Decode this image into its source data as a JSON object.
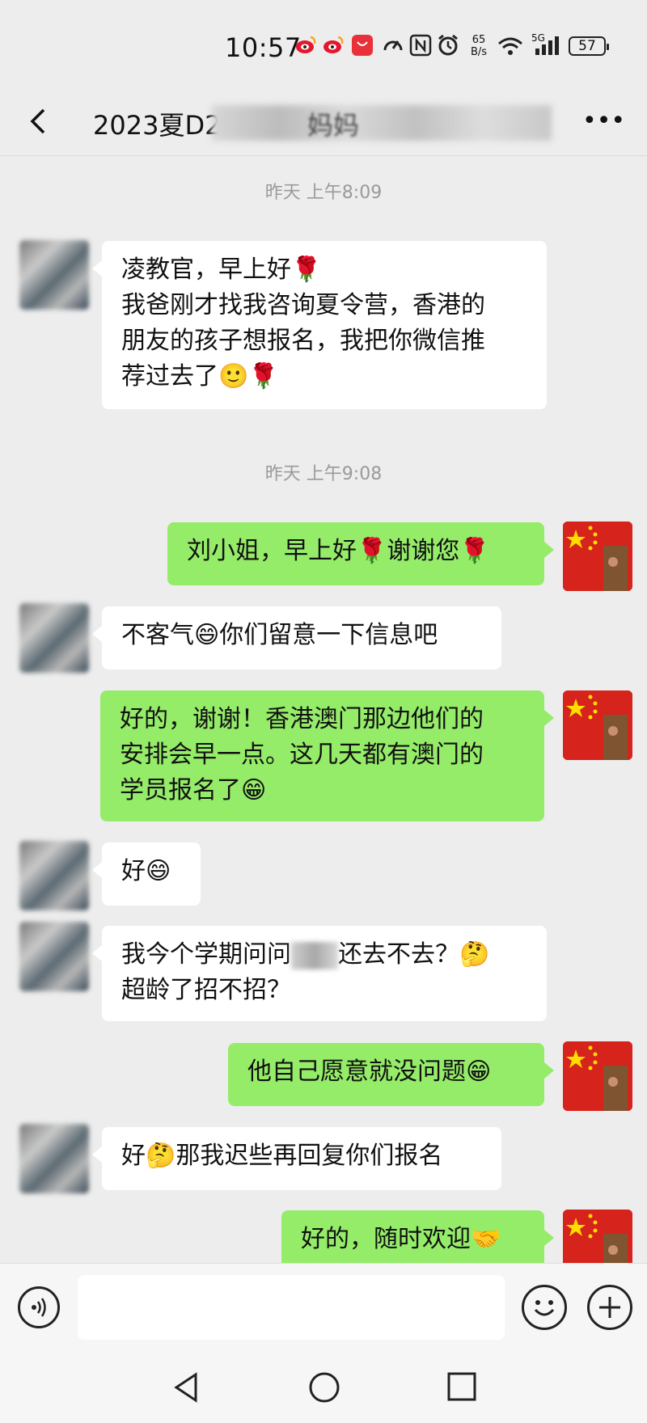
{
  "status": {
    "time": "10:57",
    "net_speed_value": "65",
    "net_speed_unit": "B/s",
    "signal_label": "5G",
    "battery": "57",
    "icons": [
      "weibo-icon",
      "weibo-icon",
      "huawei-app-icon",
      "speed-icon",
      "nfc-icon",
      "alarm-icon",
      "wifi-icon",
      "signal-icon",
      "battery-icon"
    ]
  },
  "header": {
    "title": "2023夏D2",
    "title_tail": "妈妈"
  },
  "messages": [
    {
      "type": "time",
      "text": "昨天 上午8:09"
    },
    {
      "type": "msg",
      "side": "left",
      "lines": [
        "凌教官，早上好🌹",
        "我爸刚才找我咨询夏令营，香港的",
        "朋友的孩子想报名，我把你微信推",
        "荐过去了🙂🌹"
      ]
    },
    {
      "type": "time",
      "text": "昨天 上午9:08"
    },
    {
      "type": "msg",
      "side": "right",
      "lines": [
        "刘小姐，早上好🌹谢谢您🌹"
      ]
    },
    {
      "type": "msg",
      "side": "left",
      "lines": [
        "不客气😄你们留意一下信息吧"
      ]
    },
    {
      "type": "msg",
      "side": "right",
      "lines": [
        "好的，谢谢！香港澳门那边他们的",
        "安排会早一点。这几天都有澳门的",
        "学员报名了😁"
      ]
    },
    {
      "type": "msg",
      "side": "left",
      "lines": [
        "好😄"
      ]
    },
    {
      "type": "msg",
      "side": "left",
      "line1_a": "我今个学期问问",
      "line1_b": "还去不去？🤔",
      "line2": "超龄了招不招？"
    },
    {
      "type": "msg",
      "side": "right",
      "lines": [
        "他自己愿意就没问题😁"
      ]
    },
    {
      "type": "msg",
      "side": "left",
      "lines": [
        "好🤔那我迟些再回复你们报名"
      ]
    },
    {
      "type": "msg",
      "side": "right",
      "lines": [
        "好的，随时欢迎🤝"
      ]
    }
  ],
  "input": {
    "placeholder": "",
    "voice_icon": "voice-icon",
    "emoji_icon": "emoji-icon",
    "plus_icon": "plus-icon"
  },
  "colors": {
    "bg": "#ededed",
    "bubble_left": "#ffffff",
    "bubble_right": "#95ec69"
  }
}
